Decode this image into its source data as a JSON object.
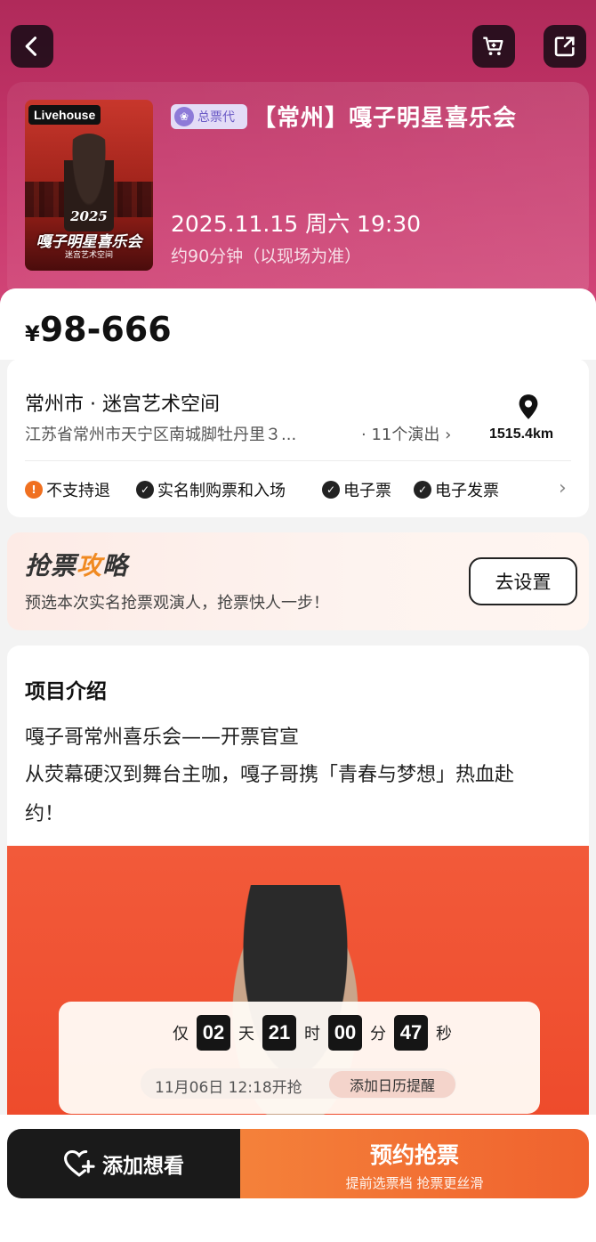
{
  "colors": {
    "hero": "#c43569",
    "accent_orange": "#f0622e",
    "agent_badge": "#6b5bc6"
  },
  "icons": {
    "back": "chevron-left-icon",
    "cart": "cart-icon",
    "share": "share-icon",
    "location": "map-pin-icon",
    "heart_add": "heart-plus-icon"
  },
  "poster": {
    "tag": "Livehouse",
    "year": "2025",
    "title": "嘎子明星喜乐会",
    "subtitle": "迷宫艺术空间"
  },
  "event": {
    "agent_badge": "总票代",
    "title": "【常州】嘎子明星喜乐会",
    "datetime": "2025.11.15 周六 19:30",
    "duration": "约90分钟（以现场为准）"
  },
  "price": {
    "currency": "¥",
    "range": "98-666"
  },
  "venue": {
    "name": "常州市 · 迷宫艺术空间",
    "address": "江苏省常州市天宁区南城脚牡丹里３...",
    "shows": "· 11个演出 ›",
    "distance": "1515.4km"
  },
  "policies": [
    {
      "label": "不支持退",
      "type": "warn",
      "mark": "!"
    },
    {
      "label": "实名制购票和入场",
      "type": "check",
      "mark": "✓"
    },
    {
      "label": "电子票",
      "type": "check",
      "mark": "✓"
    },
    {
      "label": "电子发票",
      "type": "check",
      "mark": "✓"
    }
  ],
  "strategy": {
    "title_a": "抢票",
    "title_b": "攻",
    "title_c": "略",
    "desc": "预选本次实名抢票观演人，抢票快人一步！",
    "button": "去设置"
  },
  "intro": {
    "heading": "项目介绍",
    "line1": "嘎子哥常州喜乐会——开票官宣",
    "line2": "从荧幕硬汉到舞台主咖，嘎子哥携「青春与梦想」热血赴",
    "line3": "约！"
  },
  "countdown": {
    "prefix": "仅",
    "days": "02",
    "days_unit": "天",
    "hours": "21",
    "hours_unit": "时",
    "minutes": "00",
    "minutes_unit": "分",
    "seconds": "47",
    "seconds_unit": "秒",
    "sale_time": "11月06日 12:18开抢",
    "remind_label": "添加日历提醒"
  },
  "bottom": {
    "want_label": "添加想看",
    "book_label": "预约抢票",
    "book_sub": "提前选票档 抢票更丝滑"
  }
}
